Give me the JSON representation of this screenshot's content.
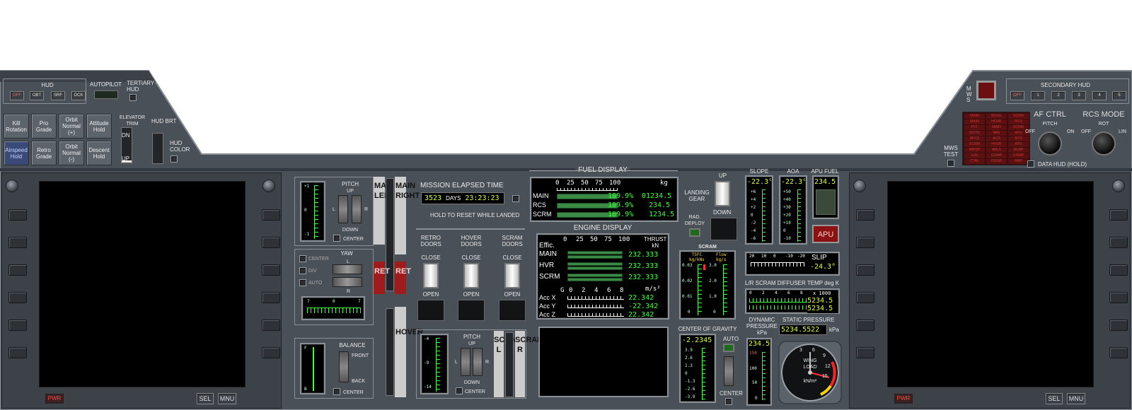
{
  "hud": {
    "title": "HUD",
    "modes": [
      "OFF",
      "OBT",
      "SRF",
      "DCK"
    ],
    "autopilot_label": "AUTOPILOT",
    "tertiary_label": "TERTIARY\nHUD"
  },
  "autopilot": {
    "buttons": [
      [
        "Kill Rotation",
        "Pro Grade",
        "Orbit Normal (+)",
        "Attitude Hold"
      ],
      [
        "Airspeed Hold",
        "Retro Grade",
        "Orbit Normal (-)",
        "Descent Hold"
      ]
    ]
  },
  "elevator_trim": {
    "label": "ELEVATOR TRIM",
    "dn": "DN",
    "up": "UP"
  },
  "hud_brt": {
    "label": "HUD BRT"
  },
  "hud_color": {
    "label": "HUD COLOR"
  },
  "mfd_left": {
    "pwr": "PWR",
    "sel": "SEL",
    "mnu": "MNU"
  },
  "mfd_right": {
    "pwr": "PWR",
    "sel": "SEL",
    "mnu": "MNU"
  },
  "pitch_left": {
    "title": "PITCH",
    "up": "UP",
    "down": "DOWN",
    "center": "CENTER",
    "l": "L",
    "r": "R",
    "scale": [
      "+1",
      "0",
      "-1"
    ]
  },
  "yaw": {
    "title": "YAW",
    "center": "CENTER",
    "div": "DIV",
    "auto": "AUTO",
    "l": "L",
    "r": "R",
    "left": "LEFT",
    "right": "RIGHT",
    "scale": [
      "7",
      "0",
      "7"
    ]
  },
  "balance": {
    "title": "BALANCE",
    "front": "FRONT",
    "back": "BACK",
    "center": "CENTER",
    "f": "F",
    "b": "B"
  },
  "throttle_labels": {
    "main_left": "MAIN LEFT",
    "main_right": "MAIN RIGHT",
    "ret": "RET",
    "hover": "HOVER",
    "scram_l": "SCRAM L",
    "scram_r": "SCRAM R"
  },
  "met": {
    "title": "MISSION ELAPSED TIME",
    "days": "3523",
    "days_label": "DAYS",
    "time": "23:23:23",
    "note": "HOLD TO RESET WHILE LANDED"
  },
  "doors": {
    "retro": "RETRO\nDOORS",
    "hover": "HOVER\nDOORS",
    "scram": "SCRAM\nDOORS",
    "close": "CLOSE",
    "open": "OPEN"
  },
  "pitch_scram": {
    "title": "PITCH",
    "up": "UP",
    "down": "DOWN",
    "center": "CENTER",
    "l": "L",
    "r": "R",
    "scale": [
      "-4",
      "-9",
      "-14"
    ]
  },
  "fuel_display": {
    "title": "FUEL DISPLAY",
    "scale": [
      "0",
      "25",
      "50",
      "75",
      "100"
    ],
    "unit": "kg",
    "rows": [
      {
        "name": "MAIN",
        "pct": "189.9%",
        "kg": "01234.5",
        "level": 1.0
      },
      {
        "name": "RCS",
        "pct": "189.9%",
        "kg": "234.5",
        "level": 1.0
      },
      {
        "name": "SCRM",
        "pct": "189.9%",
        "kg": "1234.5",
        "level": 1.0
      }
    ]
  },
  "engine_display": {
    "title": "ENGINE DISPLAY",
    "effic": "Effic.",
    "scale": [
      "0",
      "25",
      "50",
      "75",
      "100"
    ],
    "thrust_label": "THRUST\nkN",
    "rows": [
      {
        "name": "MAIN",
        "value": "232.333"
      },
      {
        "name": "HVR",
        "value": "232.333"
      },
      {
        "name": "SCRM",
        "value": "232.333"
      }
    ],
    "g_label": "G",
    "acc_scale": [
      "0",
      "2",
      "4",
      "6",
      "8"
    ],
    "acc_unit": "m/s²",
    "acc": [
      {
        "name": "Acc X",
        "value": "22.342"
      },
      {
        "name": "Acc Y",
        "value": "-22.342"
      },
      {
        "name": "Acc Z",
        "value": "22.342"
      }
    ]
  },
  "landing_gear": {
    "label": "LANDING\nGEAR",
    "up": "UP",
    "down": "DOWN",
    "rad_deploy": "RAD.\nDEPLOY"
  },
  "scram": {
    "title": "SCRAM",
    "tsfc": "TSFC\nkg/kNs",
    "flow": "Flow\nkg/s",
    "tsfc_scale": [
      "0.03",
      "0.02",
      "0.01",
      "0"
    ],
    "flow_scale": [
      "3.0",
      "2.0",
      "1.0",
      "0"
    ]
  },
  "center_of_gravity": {
    "title": "CENTER OF GRAVITY",
    "value": "-2.2345",
    "scale": [
      "3.9",
      "2.6",
      "1.3",
      "0",
      "-1.3",
      "-2.6",
      "-3.9"
    ],
    "auto": "AUTO",
    "center": "CENTER"
  },
  "slope": {
    "title": "SLOPE",
    "value": "-22.3°",
    "scale": [
      "+6",
      "+4",
      "+2",
      "0",
      "-2",
      "-4",
      "-6"
    ]
  },
  "aoa": {
    "title": "AOA",
    "value": "-22.3°",
    "scale": [
      "+50",
      "+40",
      "+30",
      "+20",
      "+10",
      "0",
      "-10"
    ]
  },
  "apu_fuel": {
    "title": "APU FUEL",
    "value": "234.5",
    "button": "APU"
  },
  "slip": {
    "title": "SLIP",
    "value": "-24.3°",
    "scale": [
      "20",
      "10",
      "0",
      "-10",
      "-20"
    ]
  },
  "scram_diffuser": {
    "title": "L/R SCRAM DIFFUSER TEMP deg K",
    "scale": [
      "0",
      "2",
      "4",
      "6",
      "8"
    ],
    "mult": "x 1000",
    "left": "5234.5",
    "right": "5234.5"
  },
  "dynamic_pressure": {
    "title": "DYNAMIC\nPRESSURE\nkPa",
    "value": "234.5",
    "scale": [
      "150",
      "100",
      "50",
      "0"
    ]
  },
  "static_pressure": {
    "title": "STATIC PRESSURE",
    "value": "5234.5522",
    "unit": "kPa"
  },
  "wing_load": {
    "label": "WING\nLOAD",
    "unit": "kN/m²",
    "dial": [
      "3",
      "6",
      "9",
      "12",
      "15"
    ]
  },
  "secondary_hud": {
    "title": "SECONDARY HUD",
    "off": "OFF",
    "modes": [
      "1",
      "2",
      "3",
      "4",
      "5"
    ],
    "mws": "M\nW\nS",
    "mws_test": "MWS\nTEST"
  },
  "warning_panel": {
    "cells": [
      "MAIN",
      "ROUE",
      "SCRM",
      "MAIN",
      "HOVR",
      "RCS",
      "PVT",
      "MAIN",
      "SCRM",
      "ROTN",
      "NAV",
      "APU",
      "AFCS",
      "ACS",
      "RCS",
      "SCRM",
      "HYDR",
      "APU",
      "MWSP",
      "ARLS",
      "ACAP",
      "LOX",
      "COMP",
      "COMP",
      "CTRL",
      "DOOR",
      "RAD"
    ]
  },
  "af_ctrl": {
    "title": "AF CTRL",
    "pitch": "PITCH",
    "off": "OFF",
    "on": "ON"
  },
  "rcs_mode": {
    "title": "RCS MODE",
    "rot": "ROT",
    "off": "OFF",
    "lin": "LIN"
  },
  "data_hud": {
    "label": "DATA HUD (HOLD)"
  },
  "colors": {
    "panel": "#4a5058",
    "lcd_green": "#39ff39",
    "lcd_yellow": "#d9ff39",
    "warning_red": "#5a1010",
    "frame": "#8a9098"
  }
}
